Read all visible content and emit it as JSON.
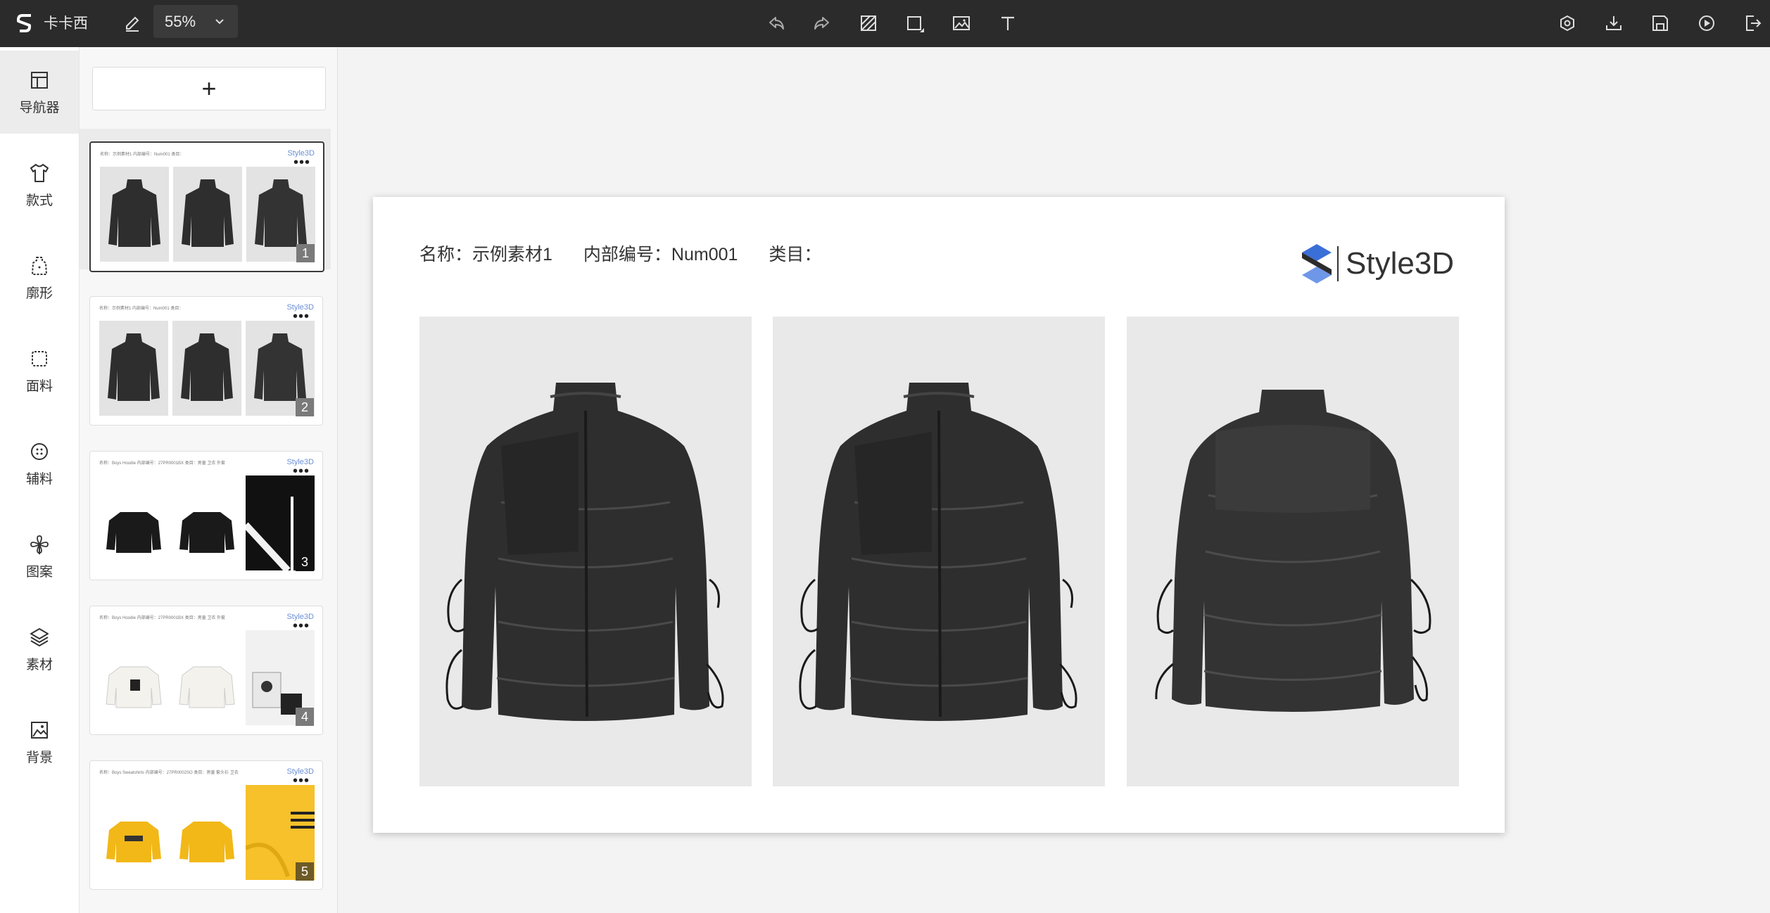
{
  "app": {
    "brand": "卡卡西"
  },
  "toolbar": {
    "zoom_value": "55%",
    "left_icons": [
      "logo-icon",
      "edit-icon"
    ],
    "center_icons": [
      "undo-icon",
      "redo-icon",
      "shape-slash-icon",
      "rectangle-icon",
      "image-icon",
      "text-icon"
    ],
    "right_icons": [
      "preview-icon",
      "download-icon",
      "save-icon",
      "play-icon",
      "exit-icon"
    ]
  },
  "rail": {
    "items": [
      {
        "label": "导航器",
        "icon": "layout-icon",
        "active": true
      },
      {
        "label": "款式",
        "icon": "tshirt-icon"
      },
      {
        "label": "廓形",
        "icon": "silhouette-icon"
      },
      {
        "label": "面料",
        "icon": "fabric-icon"
      },
      {
        "label": "辅料",
        "icon": "button-icon"
      },
      {
        "label": "图案",
        "icon": "pattern-icon"
      },
      {
        "label": "素材",
        "icon": "layers-icon"
      },
      {
        "label": "背景",
        "icon": "background-icon"
      }
    ]
  },
  "panel": {
    "add_label": "+",
    "pages": [
      {
        "num": "1",
        "header": "名称：示例素材1    内部编号：Num001    类目：",
        "logo": "Style3D",
        "more": "•••"
      },
      {
        "num": "2",
        "header": "名称：示例素材1    内部编号：Num001    类目：",
        "logo": "Style3D",
        "more": "•••"
      },
      {
        "num": "3",
        "header": "名称：Boys Hoodie    内部编号：27PR0001BX    类目：男童 卫衣 外套",
        "logo": "Style3D",
        "more": "•••"
      },
      {
        "num": "4",
        "header": "名称：Boys Hoodie    内部编号：27PR0001BX    类目：男童 卫衣 外套",
        "logo": "Style3D",
        "more": "•••"
      },
      {
        "num": "5",
        "header": "名称：Boys Sweatshirts    内部编号：27PR0002SO    类目：男童 套头衫 卫衣",
        "logo": "Style3D",
        "more": "•••"
      }
    ]
  },
  "slide": {
    "name": "名称：示例素材1",
    "code": "内部编号：Num001",
    "category": "类目：",
    "logo_text": "Style3D",
    "colors": {
      "jacket": "#2e2e2e",
      "photo_bg": "#e9e9e9",
      "logo_blue": "#3b6fd8"
    }
  }
}
